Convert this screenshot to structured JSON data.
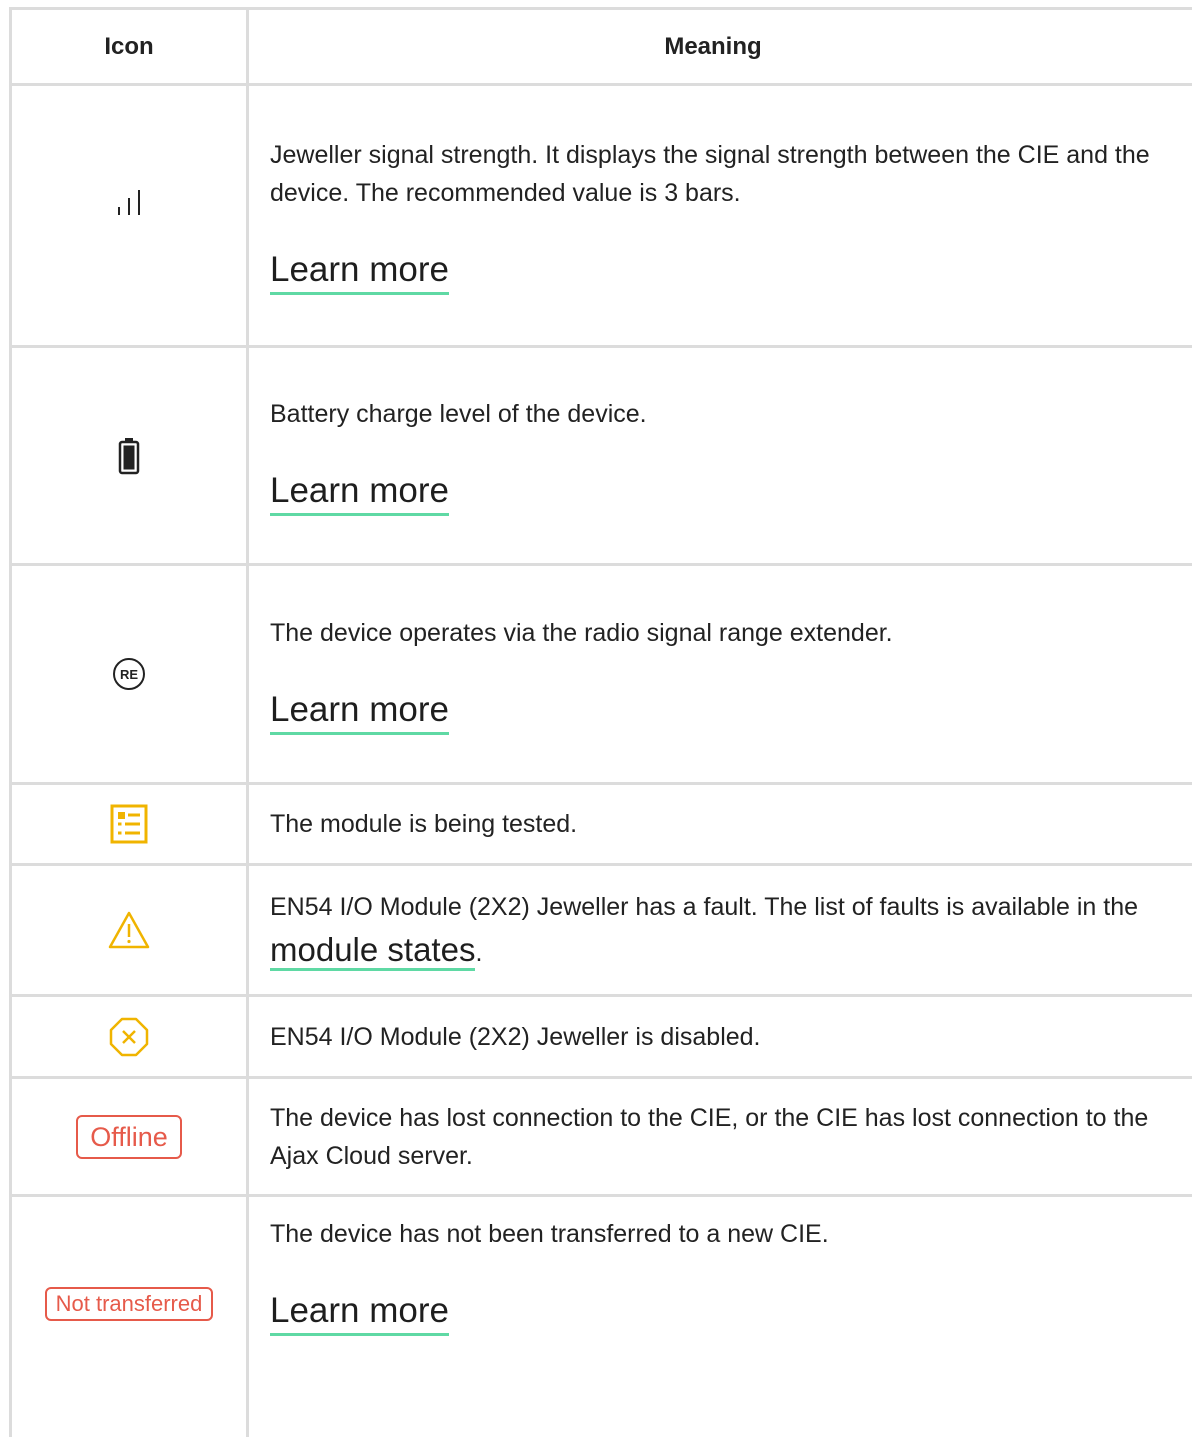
{
  "table": {
    "header": {
      "icon": "Icon",
      "meaning": "Meaning"
    },
    "rows": [
      {
        "icon": "signal-strength-icon",
        "text": "Jeweller signal strength. It displays the signal strength between the CIE and the device. The recommended value is 3 bars.",
        "link": "Learn more"
      },
      {
        "icon": "battery-icon",
        "text": "Battery charge level of the device.",
        "link": "Learn more"
      },
      {
        "icon": "range-extender-icon",
        "icon_text": "RE",
        "text": "The device operates via the radio signal range extender.",
        "link": "Learn more"
      },
      {
        "icon": "test-list-icon",
        "text": "The module is being tested."
      },
      {
        "icon": "warning-icon",
        "text_before": "EN54 I/O Module (2X2) Jeweller has a fault. The list of faults is available in the",
        "link": "module states",
        "text_after": "."
      },
      {
        "icon": "disabled-icon",
        "text": "EN54 I/O Module (2X2) Jeweller is disabled."
      },
      {
        "icon": "offline-badge",
        "badge": "Offline",
        "text": "The device has lost connection to the CIE, or the CIE has lost connection to the Ajax Cloud server."
      },
      {
        "icon": "not-transferred-badge",
        "badge": "Not transferred",
        "text": "The device has not been transferred to a new CIE.",
        "link": "Learn more"
      }
    ]
  },
  "colors": {
    "border": "#dcdcdc",
    "link_underline": "#5fd9a4",
    "warning": "#f0b400",
    "badge_red": "#e65a4a"
  }
}
